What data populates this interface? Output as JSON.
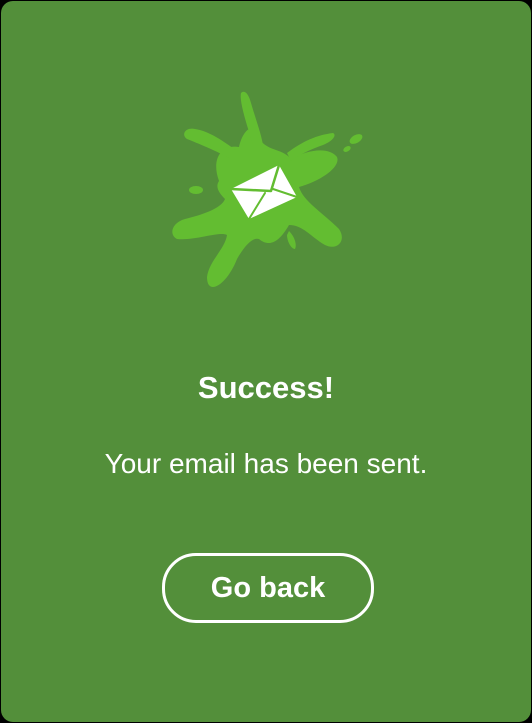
{
  "dialog": {
    "icon": "email-sent-splat-icon",
    "title": "Success!",
    "message": "Your email has been sent.",
    "back_button_label": "Go back"
  },
  "colors": {
    "background": "#538f3a",
    "splat": "#63bd31",
    "text": "#ffffff"
  }
}
